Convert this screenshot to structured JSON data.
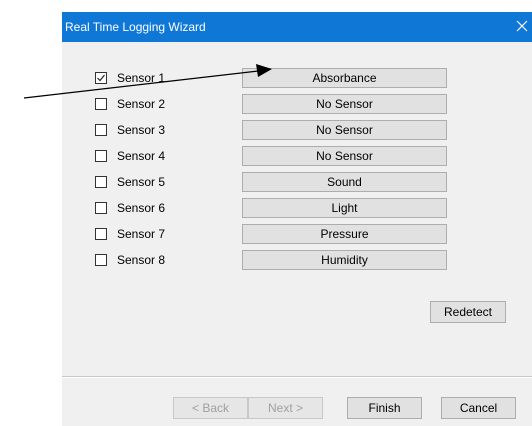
{
  "window": {
    "title": "Real Time Logging Wizard",
    "close_icon": "close-icon",
    "titlebar_color": "#0f78d7"
  },
  "sensors": [
    {
      "label": "Sensor 1",
      "checked": true,
      "type": "Absorbance"
    },
    {
      "label": "Sensor 2",
      "checked": false,
      "type": "No Sensor"
    },
    {
      "label": "Sensor 3",
      "checked": false,
      "type": "No Sensor"
    },
    {
      "label": "Sensor 4",
      "checked": false,
      "type": "No Sensor"
    },
    {
      "label": "Sensor 5",
      "checked": false,
      "type": "Sound"
    },
    {
      "label": "Sensor 6",
      "checked": false,
      "type": "Light"
    },
    {
      "label": "Sensor 7",
      "checked": false,
      "type": "Pressure"
    },
    {
      "label": "Sensor 8",
      "checked": false,
      "type": "Humidity"
    }
  ],
  "buttons": {
    "redetect": "Redetect",
    "back": "< Back",
    "next": "Next >",
    "finish": "Finish",
    "cancel": "Cancel"
  },
  "annotation": {
    "icon": "arrow-annotation-icon"
  }
}
